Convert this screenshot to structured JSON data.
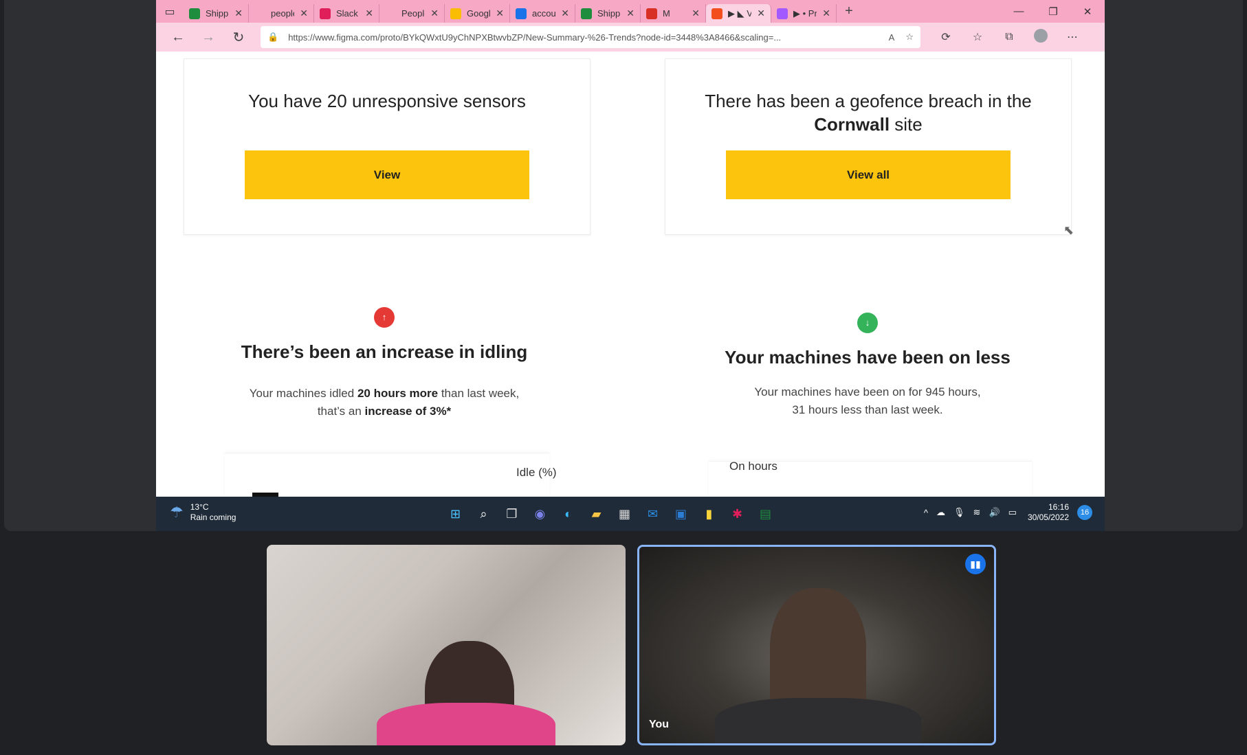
{
  "tabs": [
    {
      "label": "Shippi",
      "color": "#1e8e3e"
    },
    {
      "label": "people",
      "color": "#f7a8c5"
    },
    {
      "label": "Slack |",
      "color": "#e01e5a"
    },
    {
      "label": "People",
      "color": "#f7a8c5"
    },
    {
      "label": "Googl",
      "color": "#fbbc04"
    },
    {
      "label": "accour",
      "color": "#1a73e8"
    },
    {
      "label": "Shippi",
      "color": "#1e8e3e"
    },
    {
      "label": "M",
      "color": "#d93025"
    },
    {
      "label": "▶ ◣ V",
      "color": "#f24e1e"
    },
    {
      "label": "▶ • Pr",
      "color": "#a259ff"
    }
  ],
  "address": {
    "url": "https://www.figma.com/proto/BYkQWxtU9yChNPXBtwvbZP/New-Summary-%26-Trends?node-id=3448%3A8466&scaling=..."
  },
  "cards": {
    "sensors": {
      "title": "You have 20 unresponsive sensors",
      "button": "View"
    },
    "geofence": {
      "title_pre": "There has been a geofence breach in the",
      "site": "Cornwall",
      "title_post": " site",
      "button": "View all"
    }
  },
  "idling": {
    "heading": "There’s been an increase in idling",
    "p1": "Your machines idled ",
    "b1": "20 hours more",
    "p2": " than last week,",
    "p3": "that’s an ",
    "b2": "increase of 3%*",
    "chart_label": "Idle (%)"
  },
  "onhours": {
    "heading": "Your machines have been on less",
    "line1": "Your machines have been on for 945 hours,",
    "line2": "31 hours less than last week.",
    "chart_label": "On hours"
  },
  "taskbar": {
    "temp": "13°C",
    "weather": "Rain coming",
    "time": "16:16",
    "date": "30/05/2022",
    "notifications": "16"
  },
  "participants": {
    "self_label": "You"
  }
}
